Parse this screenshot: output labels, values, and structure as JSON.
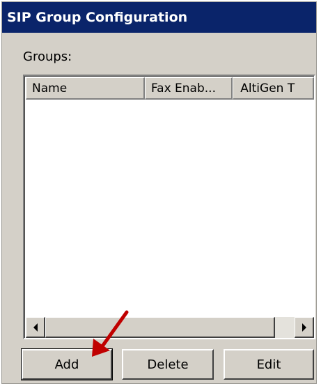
{
  "window": {
    "title": "SIP Group Configuration"
  },
  "groups": {
    "label": "Groups:",
    "columns": [
      "Name",
      "Fax Enab...",
      "AltiGen T"
    ],
    "rows": []
  },
  "buttons": {
    "add": "Add",
    "delete": "Delete",
    "edit": "Edit"
  },
  "annotation": {
    "arrow_color": "#c00000"
  },
  "colors": {
    "title_bar": "#0a246a",
    "panel": "#d4d0c8"
  }
}
